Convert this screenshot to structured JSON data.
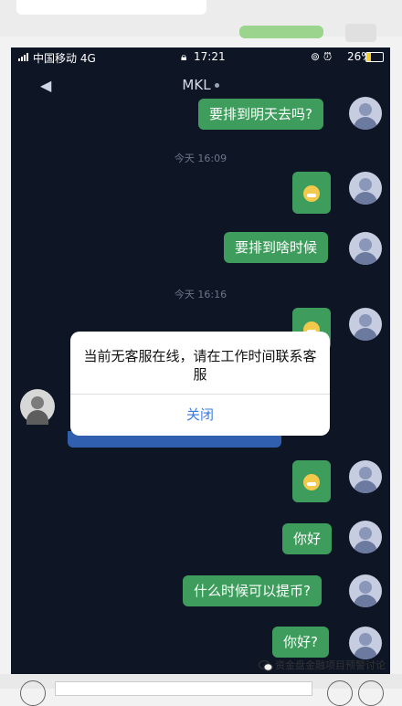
{
  "status_bar": {
    "carrier": "中国移动  4G",
    "time": "17:21",
    "battery": "26%"
  },
  "header": {
    "title": "MKL",
    "back_icon": "chevron-left-icon"
  },
  "messages": [
    {
      "text": "要排到明天去吗?",
      "sender": "me"
    },
    {
      "text": "今天 16:09",
      "type": "timestamp"
    },
    {
      "type": "emoji",
      "sender": "me"
    },
    {
      "text": "要排到啥时候",
      "sender": "me"
    },
    {
      "text": "今天 16:16",
      "type": "timestamp"
    },
    {
      "type": "emoji",
      "sender": "me"
    },
    {
      "type": "emoji",
      "sender": "me"
    },
    {
      "text": "你好",
      "sender": "me"
    },
    {
      "text": "什么时候可以提币?",
      "sender": "me"
    },
    {
      "text": "你好?",
      "sender": "me"
    }
  ],
  "dialog": {
    "message": "当前无客服在线，请在工作时间联系客服",
    "close_label": "关闭"
  },
  "watermark": "资金盘金融项目预警讨论",
  "colors": {
    "chat_background": "#0e1626",
    "bubble_green": "#3e9d5c",
    "dialog_button": "#3b7be0"
  }
}
